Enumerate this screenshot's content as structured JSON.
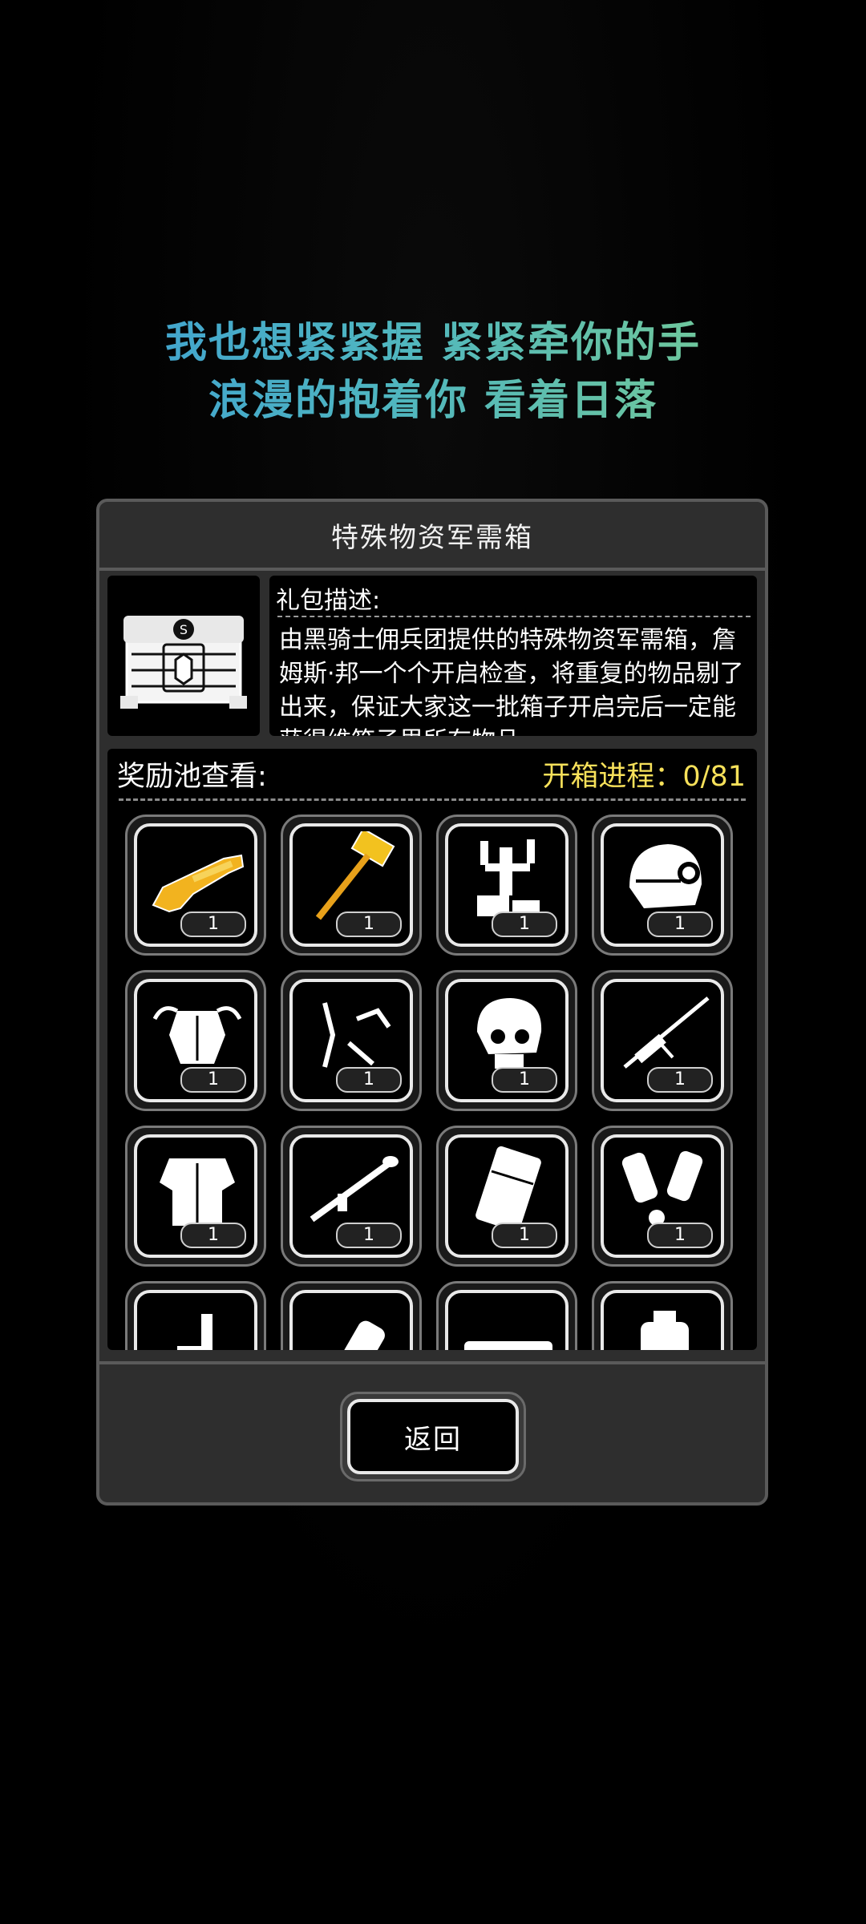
{
  "lyrics": {
    "line1": "我也想紧紧握 紧紧牵你的手",
    "line2": "浪漫的抱着你 看着日落"
  },
  "dialog": {
    "title": "特殊物资军需箱",
    "description_label": "礼包描述:",
    "description": "由黑骑士佣兵团提供的特殊物资军需箱，詹姆斯·邦一个个开启检查，将重复的物品剔了出来，保证大家这一批箱子开启完后一定能获得维箱子里所有物品",
    "pool_label": "奖励池查看:",
    "progress": "开箱进程：0/81",
    "back_label": "返回"
  },
  "rewards": [
    {
      "icon": "golden-shotgun-icon",
      "qty": "1"
    },
    {
      "icon": "golden-hammer-icon",
      "qty": "1"
    },
    {
      "icon": "robot-arm-device-icon",
      "qty": "1"
    },
    {
      "icon": "combat-helmet-icon",
      "qty": "1"
    },
    {
      "icon": "power-armor-torso-icon",
      "qty": "1"
    },
    {
      "icon": "mechanical-arm-parts-icon",
      "qty": "1"
    },
    {
      "icon": "skull-helmet-icon",
      "qty": "1"
    },
    {
      "icon": "sniper-rifle-icon",
      "qty": "1"
    },
    {
      "icon": "body-armor-icon",
      "qty": "1"
    },
    {
      "icon": "rocket-launcher-icon",
      "qty": "1"
    },
    {
      "icon": "ammo-crate-icon",
      "qty": "1"
    },
    {
      "icon": "gauntlets-icon",
      "qty": "1"
    },
    {
      "icon": "minigun-icon",
      "qty": ""
    },
    {
      "icon": "drill-weapon-icon",
      "qty": ""
    },
    {
      "icon": "heavy-cannon-icon",
      "qty": ""
    },
    {
      "icon": "backpack-icon",
      "qty": ""
    }
  ],
  "colors": {
    "progress": "#f7e15a",
    "gold": "#f2b31f",
    "lyric_start": "#3a9ad6",
    "lyric_end": "#7fd08a"
  }
}
